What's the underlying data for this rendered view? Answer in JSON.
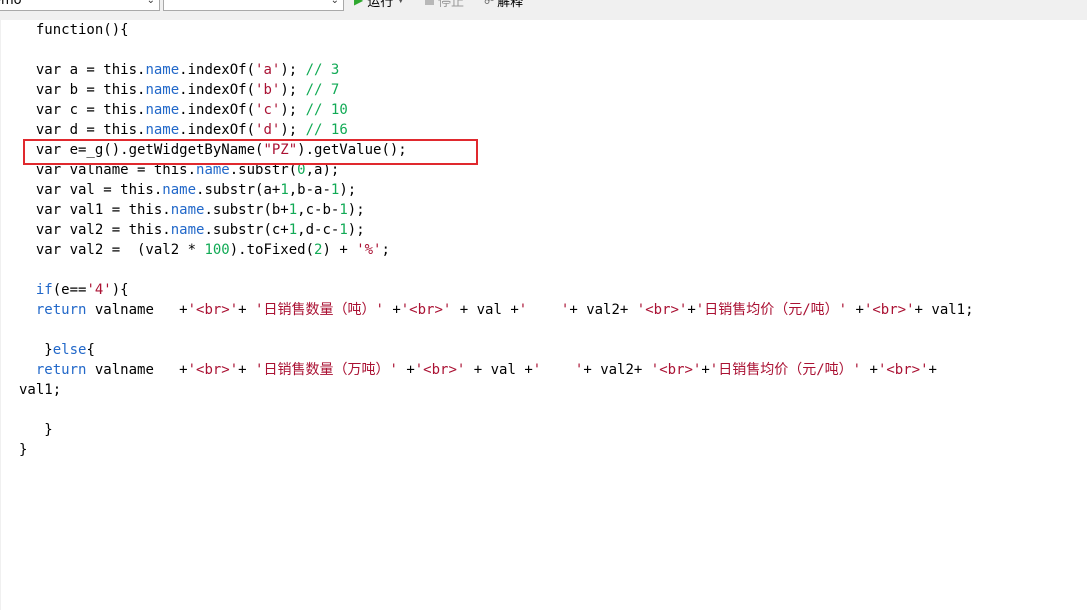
{
  "toolbar": {
    "select1_value": "emo",
    "select2_value": "",
    "run_label": "运行",
    "stop_label": "停止",
    "explain_label": "解释"
  },
  "code": {
    "highlighted_line": 7,
    "lines": [
      [
        {
          "t": "  function(){"
        }
      ],
      [
        {
          "t": ""
        }
      ],
      [
        {
          "t": "  var a = this."
        },
        {
          "t": "name",
          "c": "p"
        },
        {
          "t": ".indexOf("
        },
        {
          "t": "'a'",
          "c": "s"
        },
        {
          "t": "); "
        },
        {
          "t": "// 3",
          "c": "c"
        }
      ],
      [
        {
          "t": "  var b = this."
        },
        {
          "t": "name",
          "c": "p"
        },
        {
          "t": ".indexOf("
        },
        {
          "t": "'b'",
          "c": "s"
        },
        {
          "t": "); "
        },
        {
          "t": "// 7",
          "c": "c"
        }
      ],
      [
        {
          "t": "  var c = this."
        },
        {
          "t": "name",
          "c": "p"
        },
        {
          "t": ".indexOf("
        },
        {
          "t": "'c'",
          "c": "s"
        },
        {
          "t": "); "
        },
        {
          "t": "// 10",
          "c": "c"
        }
      ],
      [
        {
          "t": "  var d = this."
        },
        {
          "t": "name",
          "c": "p"
        },
        {
          "t": ".indexOf("
        },
        {
          "t": "'d'",
          "c": "s"
        },
        {
          "t": "); "
        },
        {
          "t": "// 16",
          "c": "c"
        }
      ],
      [
        {
          "t": "  var e=_g().getWidgetByName("
        },
        {
          "t": "\"PZ\"",
          "c": "s"
        },
        {
          "t": ").getValue();"
        }
      ],
      [
        {
          "t": "  var valname = this."
        },
        {
          "t": "name",
          "c": "p"
        },
        {
          "t": ".substr("
        },
        {
          "t": "0",
          "c": "n"
        },
        {
          "t": ",a);"
        }
      ],
      [
        {
          "t": "  var val = this."
        },
        {
          "t": "name",
          "c": "p"
        },
        {
          "t": ".substr(a+"
        },
        {
          "t": "1",
          "c": "n"
        },
        {
          "t": ",b-a-"
        },
        {
          "t": "1",
          "c": "n"
        },
        {
          "t": ");"
        }
      ],
      [
        {
          "t": "  var val1 = this."
        },
        {
          "t": "name",
          "c": "p"
        },
        {
          "t": ".substr(b+"
        },
        {
          "t": "1",
          "c": "n"
        },
        {
          "t": ",c-b-"
        },
        {
          "t": "1",
          "c": "n"
        },
        {
          "t": ");"
        }
      ],
      [
        {
          "t": "  var val2 = this."
        },
        {
          "t": "name",
          "c": "p"
        },
        {
          "t": ".substr(c+"
        },
        {
          "t": "1",
          "c": "n"
        },
        {
          "t": ",d-c-"
        },
        {
          "t": "1",
          "c": "n"
        },
        {
          "t": ");"
        }
      ],
      [
        {
          "t": "  var val2 =  (val2 * "
        },
        {
          "t": "100",
          "c": "n"
        },
        {
          "t": ").toFixed("
        },
        {
          "t": "2",
          "c": "n"
        },
        {
          "t": ") + "
        },
        {
          "t": "'%'",
          "c": "s"
        },
        {
          "t": ";"
        }
      ],
      [
        {
          "t": ""
        }
      ],
      [
        {
          "t": "  "
        },
        {
          "t": "if",
          "c": "p"
        },
        {
          "t": "(e=="
        },
        {
          "t": "'4'",
          "c": "s"
        },
        {
          "t": "){"
        }
      ],
      [
        {
          "t": "  "
        },
        {
          "t": "return",
          "c": "p"
        },
        {
          "t": " valname   +"
        },
        {
          "t": "'<br>'",
          "c": "s"
        },
        {
          "t": "+ "
        },
        {
          "t": "'日销售数量（吨）'",
          "c": "s"
        },
        {
          "t": " +"
        },
        {
          "t": "'<br>'",
          "c": "s"
        },
        {
          "t": " + val +"
        },
        {
          "t": "'    '",
          "c": "s"
        },
        {
          "t": "+ val2+ "
        },
        {
          "t": "'<br>'",
          "c": "s"
        },
        {
          "t": "+"
        },
        {
          "t": "'日销售均价（元/吨）'",
          "c": "s"
        },
        {
          "t": " +"
        },
        {
          "t": "'<br>'",
          "c": "s"
        },
        {
          "t": "+ val1;"
        }
      ],
      [
        {
          "t": ""
        }
      ],
      [
        {
          "t": "   }"
        },
        {
          "t": "else",
          "c": "p"
        },
        {
          "t": "{"
        }
      ],
      [
        {
          "t": "  "
        },
        {
          "t": "return",
          "c": "p"
        },
        {
          "t": " valname   +"
        },
        {
          "t": "'<br>'",
          "c": "s"
        },
        {
          "t": "+ "
        },
        {
          "t": "'日销售数量（万吨）'",
          "c": "s"
        },
        {
          "t": " +"
        },
        {
          "t": "'<br>'",
          "c": "s"
        },
        {
          "t": " + val +"
        },
        {
          "t": "'    '",
          "c": "s"
        },
        {
          "t": "+ val2+ "
        },
        {
          "t": "'<br>'",
          "c": "s"
        },
        {
          "t": "+"
        },
        {
          "t": "'日销售均价（元/吨）'",
          "c": "s"
        },
        {
          "t": " +"
        },
        {
          "t": "'<br>'",
          "c": "s"
        },
        {
          "t": "+"
        }
      ],
      [
        {
          "t": "val1;"
        }
      ],
      [
        {
          "t": ""
        }
      ],
      [
        {
          "t": "   }"
        }
      ],
      [
        {
          "t": "}"
        }
      ]
    ]
  },
  "colors": {
    "property": "#2268c9",
    "string": "#aa1133",
    "number": "#11aa55",
    "highlight_box": "#e0292e",
    "run_icon": "#2fa82f"
  },
  "icons": {
    "run": "play-icon",
    "stop": "stop-square-icon",
    "explain": "explain-icon"
  }
}
